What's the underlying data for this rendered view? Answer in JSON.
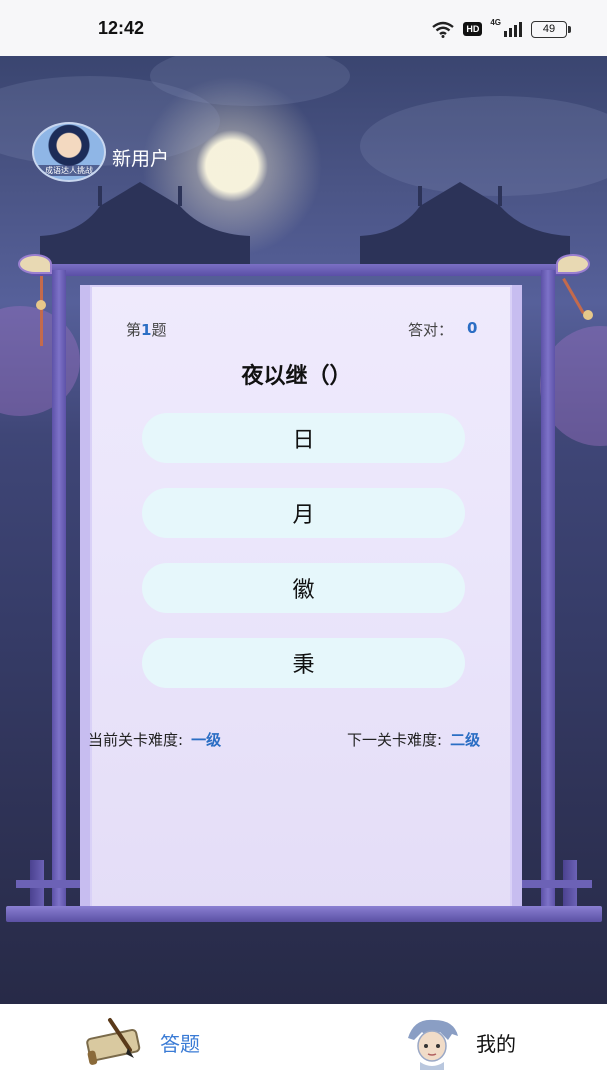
{
  "status_bar": {
    "time": "12:42",
    "network": "4G",
    "hd_badge": "HD",
    "battery": "49",
    "icons": [
      "wifi-icon",
      "hd-icon",
      "signal-icon",
      "battery-icon"
    ]
  },
  "user": {
    "avatar_caption": "成语达人挑战",
    "name": "新用户"
  },
  "quiz": {
    "question_prefix": "第",
    "question_number": "1",
    "question_suffix": "题",
    "correct_label": "答对：",
    "correct_count": "0",
    "question_text": "夜以继（）",
    "options": [
      "日",
      "月",
      "徽",
      "秉"
    ],
    "current_level_label": "当前关卡难度:",
    "current_level_value": "一级",
    "next_level_label": "下一关卡难度:",
    "next_level_value": "二级"
  },
  "bottom_nav": {
    "items": [
      {
        "label": "答题",
        "icon": "scroll-brush-icon",
        "active": true
      },
      {
        "label": "我的",
        "icon": "profile-character-icon",
        "active": false
      }
    ]
  },
  "colors": {
    "accent": "#3a7bd5",
    "option_bg": "#e6f7fb",
    "frame": "#6c62b6",
    "paper": "#ebe6fb"
  }
}
